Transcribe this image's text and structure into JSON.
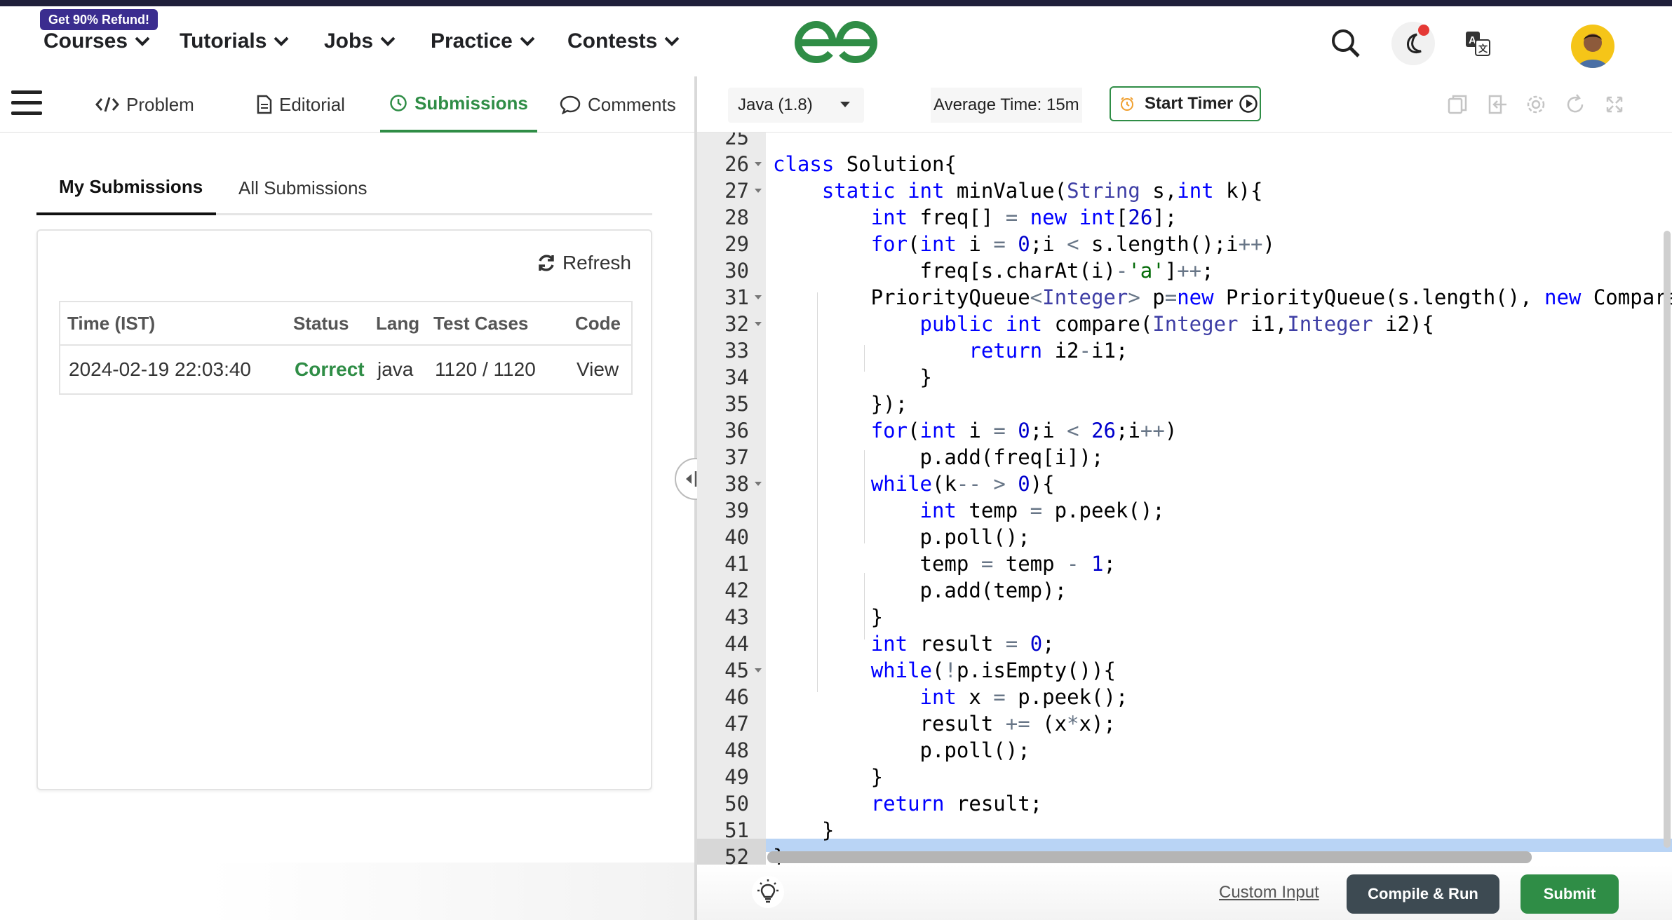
{
  "header": {
    "promo_badge": "Get 90% Refund!",
    "nav": [
      {
        "label": "Courses"
      },
      {
        "label": "Tutorials"
      },
      {
        "label": "Jobs"
      },
      {
        "label": "Practice"
      },
      {
        "label": "Contests"
      }
    ],
    "icons": {
      "logo": "geeksforgeeks-logo-icon",
      "search": "search-icon",
      "theme": "moon-icon",
      "translate": "translate-icon",
      "avatar": "user-avatar"
    },
    "brand_color": "#2f8d46"
  },
  "problem_tabs": [
    {
      "label": "Problem",
      "icon": "code-icon"
    },
    {
      "label": "Editorial",
      "icon": "document-icon"
    },
    {
      "label": "Submissions",
      "icon": "clock-icon",
      "active": true
    },
    {
      "label": "Comments",
      "icon": "comment-icon"
    }
  ],
  "submissions": {
    "subtabs": [
      {
        "label": "My Submissions",
        "active": true
      },
      {
        "label": "All Submissions"
      }
    ],
    "refresh_label": "Refresh",
    "columns": [
      "Time (IST)",
      "Status",
      "Lang",
      "Test Cases",
      "Code"
    ],
    "rows": [
      {
        "time": "2024-02-19 22:03:40",
        "status": "Correct",
        "lang": "java",
        "test_cases": "1120 / 1120",
        "code": "View"
      }
    ]
  },
  "editor_toolbar": {
    "language": "Java (1.8)",
    "average_time": "Average Time: 15m",
    "timer_label": "Start Timer",
    "icons": [
      "copy-icon",
      "import-icon",
      "settings-icon",
      "reset-icon",
      "fullscreen-icon"
    ]
  },
  "code_lines": [
    {
      "n": "25",
      "fold": false,
      "tokens": []
    },
    {
      "n": "26",
      "fold": true,
      "tokens": [
        [
          "kw",
          "class"
        ],
        [
          "",
          " Solution{"
        ]
      ]
    },
    {
      "n": "27",
      "fold": true,
      "tokens": [
        [
          "",
          "    "
        ],
        [
          "kw",
          "static"
        ],
        [
          "",
          " "
        ],
        [
          "kw",
          "int"
        ],
        [
          "",
          " minValue("
        ],
        [
          "ty",
          "String"
        ],
        [
          "",
          " s,"
        ],
        [
          "kw",
          "int"
        ],
        [
          "",
          " k){"
        ]
      ]
    },
    {
      "n": "28",
      "fold": false,
      "tokens": [
        [
          "",
          "        "
        ],
        [
          "kw",
          "int"
        ],
        [
          "",
          " freq[] "
        ],
        [
          "op",
          "="
        ],
        [
          "",
          " "
        ],
        [
          "kw",
          "new"
        ],
        [
          "",
          " "
        ],
        [
          "kw",
          "int"
        ],
        [
          "",
          "["
        ],
        [
          "nm",
          "26"
        ],
        [
          "",
          "];"
        ]
      ]
    },
    {
      "n": "29",
      "fold": false,
      "tokens": [
        [
          "",
          "        "
        ],
        [
          "kw",
          "for"
        ],
        [
          "",
          "("
        ],
        [
          "kw",
          "int"
        ],
        [
          "",
          " i "
        ],
        [
          "op",
          "="
        ],
        [
          "",
          " "
        ],
        [
          "nm",
          "0"
        ],
        [
          "",
          ";i "
        ],
        [
          "op",
          "<"
        ],
        [
          "",
          " s.length();i"
        ],
        [
          "op",
          "++"
        ],
        [
          "",
          ")"
        ]
      ]
    },
    {
      "n": "30",
      "fold": false,
      "tokens": [
        [
          "",
          "            freq[s.charAt(i)"
        ],
        [
          "op",
          "-"
        ],
        [
          "st",
          "'a'"
        ],
        [
          "",
          "]"
        ],
        [
          "op",
          "++"
        ],
        [
          "",
          ";"
        ]
      ]
    },
    {
      "n": "31",
      "fold": true,
      "tokens": [
        [
          "",
          "        PriorityQueue"
        ],
        [
          "op",
          "<"
        ],
        [
          "ty",
          "Integer"
        ],
        [
          "op",
          ">"
        ],
        [
          "",
          " p"
        ],
        [
          "op",
          "="
        ],
        [
          "kw",
          "new"
        ],
        [
          "",
          " PriorityQueue(s.length(), "
        ],
        [
          "kw",
          "new"
        ],
        [
          "",
          " Comparator"
        ]
      ]
    },
    {
      "n": "32",
      "fold": true,
      "tokens": [
        [
          "",
          "            "
        ],
        [
          "kw",
          "public"
        ],
        [
          "",
          " "
        ],
        [
          "kw",
          "int"
        ],
        [
          "",
          " compare("
        ],
        [
          "ty",
          "Integer"
        ],
        [
          "",
          " i1,"
        ],
        [
          "ty",
          "Integer"
        ],
        [
          "",
          " i2){"
        ]
      ]
    },
    {
      "n": "33",
      "fold": false,
      "tokens": [
        [
          "",
          "                "
        ],
        [
          "kw",
          "return"
        ],
        [
          "",
          " i2"
        ],
        [
          "op",
          "-"
        ],
        [
          "",
          "i1;"
        ]
      ]
    },
    {
      "n": "34",
      "fold": false,
      "tokens": [
        [
          "",
          "            }"
        ]
      ]
    },
    {
      "n": "35",
      "fold": false,
      "tokens": [
        [
          "",
          "        });"
        ]
      ]
    },
    {
      "n": "36",
      "fold": false,
      "tokens": [
        [
          "",
          "        "
        ],
        [
          "kw",
          "for"
        ],
        [
          "",
          "("
        ],
        [
          "kw",
          "int"
        ],
        [
          "",
          " i "
        ],
        [
          "op",
          "="
        ],
        [
          "",
          " "
        ],
        [
          "nm",
          "0"
        ],
        [
          "",
          ";i "
        ],
        [
          "op",
          "<"
        ],
        [
          "",
          " "
        ],
        [
          "nm",
          "26"
        ],
        [
          "",
          ";i"
        ],
        [
          "op",
          "++"
        ],
        [
          "",
          ")"
        ]
      ]
    },
    {
      "n": "37",
      "fold": false,
      "tokens": [
        [
          "",
          "            p.add(freq[i]);"
        ]
      ]
    },
    {
      "n": "38",
      "fold": true,
      "tokens": [
        [
          "",
          "        "
        ],
        [
          "kw",
          "while"
        ],
        [
          "",
          "(k"
        ],
        [
          "op",
          "--"
        ],
        [
          "",
          " "
        ],
        [
          "op",
          ">"
        ],
        [
          "",
          " "
        ],
        [
          "nm",
          "0"
        ],
        [
          "",
          "){"
        ]
      ]
    },
    {
      "n": "39",
      "fold": false,
      "tokens": [
        [
          "",
          "            "
        ],
        [
          "kw",
          "int"
        ],
        [
          "",
          " temp "
        ],
        [
          "op",
          "="
        ],
        [
          "",
          " p.peek();"
        ]
      ]
    },
    {
      "n": "40",
      "fold": false,
      "tokens": [
        [
          "",
          "            p.poll();"
        ]
      ]
    },
    {
      "n": "41",
      "fold": false,
      "tokens": [
        [
          "",
          "            temp "
        ],
        [
          "op",
          "="
        ],
        [
          "",
          " temp "
        ],
        [
          "op",
          "-"
        ],
        [
          "",
          " "
        ],
        [
          "nm",
          "1"
        ],
        [
          "",
          ";"
        ]
      ]
    },
    {
      "n": "42",
      "fold": false,
      "tokens": [
        [
          "",
          "            p.add(temp);"
        ]
      ]
    },
    {
      "n": "43",
      "fold": false,
      "tokens": [
        [
          "",
          "        }"
        ]
      ]
    },
    {
      "n": "44",
      "fold": false,
      "tokens": [
        [
          "",
          "        "
        ],
        [
          "kw",
          "int"
        ],
        [
          "",
          " result "
        ],
        [
          "op",
          "="
        ],
        [
          "",
          " "
        ],
        [
          "nm",
          "0"
        ],
        [
          "",
          ";"
        ]
      ]
    },
    {
      "n": "45",
      "fold": true,
      "tokens": [
        [
          "",
          "        "
        ],
        [
          "kw",
          "while"
        ],
        [
          "",
          "("
        ],
        [
          "op",
          "!"
        ],
        [
          "",
          "p.isEmpty()){"
        ]
      ]
    },
    {
      "n": "46",
      "fold": false,
      "tokens": [
        [
          "",
          "            "
        ],
        [
          "kw",
          "int"
        ],
        [
          "",
          " x "
        ],
        [
          "op",
          "="
        ],
        [
          "",
          " p.peek();"
        ]
      ]
    },
    {
      "n": "47",
      "fold": false,
      "tokens": [
        [
          "",
          "            result "
        ],
        [
          "op",
          "+="
        ],
        [
          "",
          " (x"
        ],
        [
          "op",
          "*"
        ],
        [
          "",
          "x);"
        ]
      ]
    },
    {
      "n": "48",
      "fold": false,
      "tokens": [
        [
          "",
          "            p.poll();"
        ]
      ]
    },
    {
      "n": "49",
      "fold": false,
      "tokens": [
        [
          "",
          "        }"
        ]
      ]
    },
    {
      "n": "50",
      "fold": false,
      "tokens": [
        [
          "",
          "        "
        ],
        [
          "kw",
          "return"
        ],
        [
          "",
          " result;"
        ]
      ]
    },
    {
      "n": "51",
      "fold": false,
      "tokens": [
        [
          "",
          "    }"
        ]
      ]
    },
    {
      "n": "52",
      "fold": false,
      "tokens": [
        [
          "",
          "}"
        ]
      ]
    }
  ],
  "footer": {
    "custom_input": "Custom Input",
    "compile_run": "Compile & Run",
    "submit": "Submit",
    "hint_icon": "lightbulb-icon"
  }
}
